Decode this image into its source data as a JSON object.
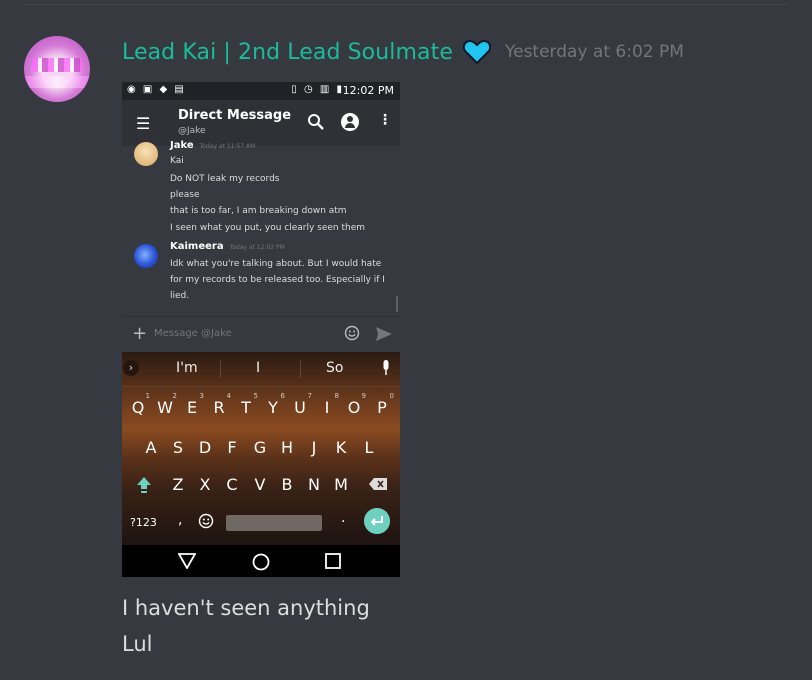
{
  "message": {
    "author": "Lead Kai | 2nd Lead Soulmate",
    "timestamp": "Yesterday at 6:02 PM",
    "accent_color": "#1abc9c",
    "badge_icon": "blue-heart-icon",
    "lines": [
      "I haven't seen anything",
      "Lul"
    ]
  },
  "screenshot": {
    "status_time": "12:02 PM",
    "appbar": {
      "title": "Direct Message",
      "subtitle": "@Jake"
    },
    "chat": {
      "jake": {
        "name": "Jake",
        "time": "Today at 11:57 AM",
        "lines": [
          "Kai",
          "Do NOT leak my records",
          "please",
          "that is too far, I am breaking down atm",
          "I seen what you put, you clearly seen them"
        ]
      },
      "kai": {
        "name": "Kaimeera",
        "time": "Today at 12:02 PM",
        "lines": [
          "Idk what you're talking about. But I would hate",
          "for my records to be released too. Especially if I",
          "lied."
        ]
      }
    },
    "input_placeholder": "Message @Jake",
    "keyboard": {
      "suggestions": [
        "I'm",
        "I",
        "So"
      ],
      "row1": [
        "Q",
        "W",
        "E",
        "R",
        "T",
        "Y",
        "U",
        "I",
        "O",
        "P"
      ],
      "row1_nums": [
        "1",
        "2",
        "3",
        "4",
        "5",
        "6",
        "7",
        "8",
        "9",
        "0"
      ],
      "row2": [
        "A",
        "S",
        "D",
        "F",
        "G",
        "H",
        "J",
        "K",
        "L"
      ],
      "row3": [
        "Z",
        "X",
        "C",
        "V",
        "B",
        "N",
        "M"
      ],
      "symbols_key": "?123",
      "comma": ",",
      "period": "."
    }
  }
}
